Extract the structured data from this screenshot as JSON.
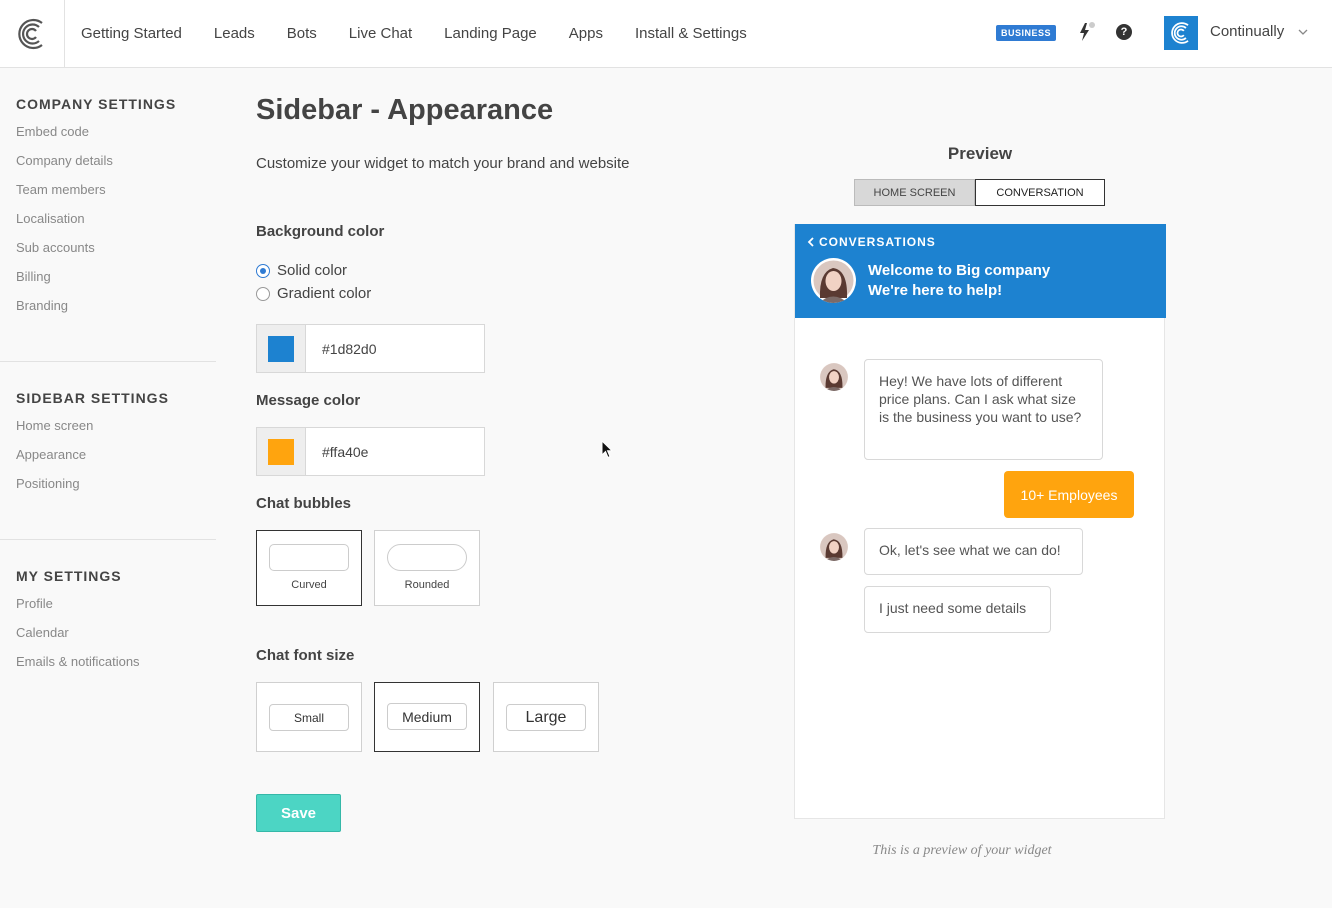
{
  "nav": {
    "items": [
      "Getting Started",
      "Leads",
      "Bots",
      "Live Chat",
      "Landing Page",
      "Apps",
      "Install & Settings"
    ],
    "badge": "BUSINESS",
    "help_glyph": "?",
    "account_name": "Continually"
  },
  "sidebar": {
    "company": {
      "title": "COMPANY SETTINGS",
      "links": [
        "Embed code",
        "Company details",
        "Team members",
        "Localisation",
        "Sub accounts",
        "Billing",
        "Branding"
      ]
    },
    "sidebar_settings": {
      "title": "SIDEBAR SETTINGS",
      "links": [
        "Home screen",
        "Appearance",
        "Positioning"
      ]
    },
    "my": {
      "title": "MY SETTINGS",
      "links": [
        "Profile",
        "Calendar",
        "Emails & notifications"
      ]
    }
  },
  "main": {
    "title": "Sidebar - Appearance",
    "subtitle": "Customize your widget to match your brand and website",
    "background": {
      "label": "Background color",
      "option_solid": "Solid color",
      "option_gradient": "Gradient color",
      "selected": "solid",
      "value": "#1d82d0"
    },
    "message": {
      "label": "Message color",
      "value": "#ffa40e"
    },
    "bubbles": {
      "label": "Chat bubbles",
      "options": [
        "Curved",
        "Rounded"
      ],
      "selected": "Curved"
    },
    "font_size": {
      "label": "Chat font size",
      "options": [
        "Small",
        "Medium",
        "Large"
      ],
      "selected": "Medium"
    },
    "save_label": "Save"
  },
  "preview": {
    "title": "Preview",
    "tabs": [
      "HOME SCREEN",
      "CONVERSATION"
    ],
    "active_tab": "CONVERSATION",
    "back_label": "CONVERSATIONS",
    "welcome": "Welcome to Big company",
    "tagline": "We're here to help!",
    "messages": [
      "Hey! We have lots of different price plans. Can I ask what size is the business you want to use?",
      "Ok, let's see what we can do!",
      "I just need some details"
    ],
    "reply": "10+ Employees",
    "note": "This is a preview of your widget"
  },
  "colors": {
    "accent": "#1d82d0",
    "message": "#ffa40e",
    "save": "#4cd5c4",
    "badge": "#2f7bd3"
  }
}
